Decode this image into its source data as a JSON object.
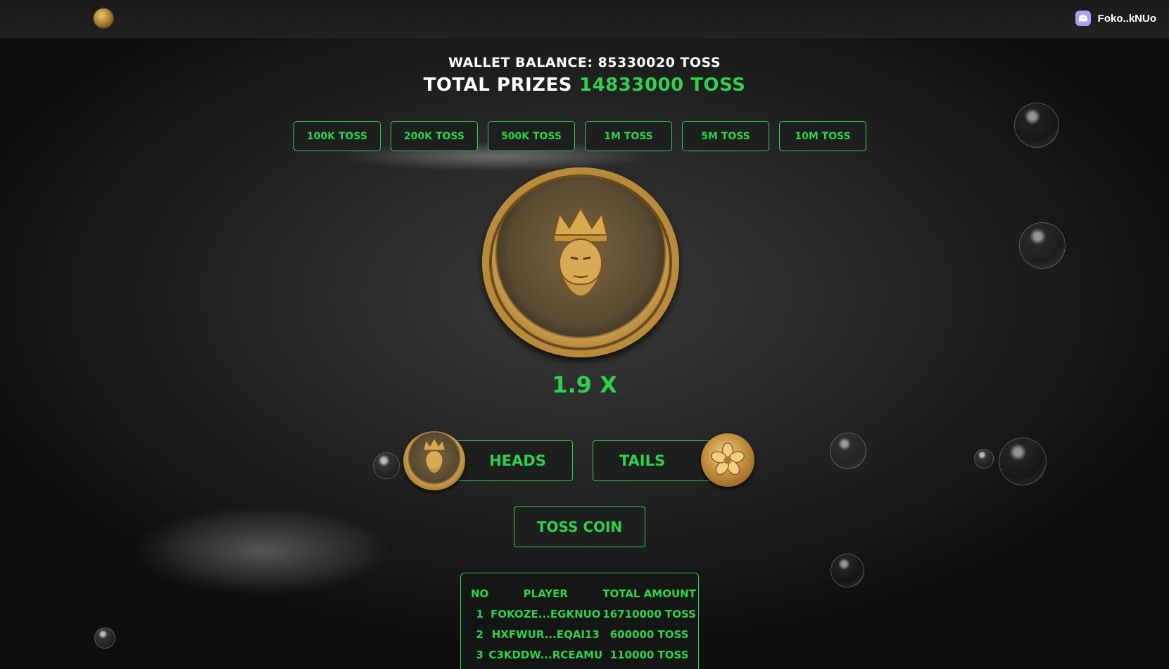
{
  "header": {
    "logo_icon": "gold-coin-logo-icon",
    "wallet_icon": "phantom-wallet-icon",
    "wallet_name": "Foko..kNUo"
  },
  "balance": {
    "wallet_text": "WALLET BALANCE: 85330020 TOSS",
    "prizes_label": "TOTAL PRIZES",
    "prizes_value": "14833000 TOSS"
  },
  "bets": [
    "100K TOSS",
    "200K TOSS",
    "500K TOSS",
    "1M TOSS",
    "5M TOSS",
    "10M TOSS"
  ],
  "coin": {
    "icon": "king-coin-icon",
    "multiplier": "1.9 X"
  },
  "choices": {
    "heads_label": "HEADS",
    "tails_label": "TAILS",
    "heads_icon": "king-coin-icon",
    "tails_icon": "flower-coin-icon"
  },
  "toss_label": "TOSS COIN",
  "leaderboard": {
    "headers": [
      "NO",
      "PLAYER",
      "TOTAL AMOUNT"
    ],
    "rows": [
      [
        "1",
        "FOKOZE...EGKNUO",
        "16710000 TOSS"
      ],
      [
        "2",
        "HXFWUR...EQAI13",
        "600000 TOSS"
      ],
      [
        "3",
        "C3KDDW...RCEAMU",
        "110000 TOSS"
      ]
    ]
  },
  "colors": {
    "accent": "#2fd14e",
    "background": "#1e1e1e"
  }
}
